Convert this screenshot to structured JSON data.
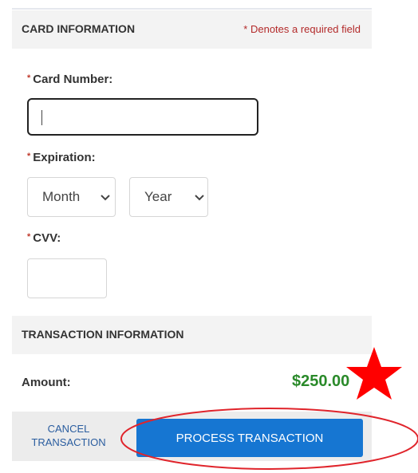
{
  "card_section": {
    "title": "CARD INFORMATION",
    "required_note": "* Denotes a required field",
    "required_mark": "*",
    "card_number_label": "Card Number:",
    "card_number_value": "",
    "expiration_label": "Expiration:",
    "month_selected": "Month",
    "year_selected": "Year",
    "cvv_label": "CVV:",
    "cvv_value": ""
  },
  "transaction_section": {
    "title": "TRANSACTION INFORMATION",
    "amount_label": "Amount:",
    "amount_value": "$250.00"
  },
  "footer": {
    "cancel_line1": "CANCEL",
    "cancel_line2": "TRANSACTION",
    "process_label": "PROCESS TRANSACTION"
  },
  "annotations": {
    "star_color": "#ff0000",
    "ellipse_color": "#e0242b"
  },
  "colors": {
    "accent": "#1676d2",
    "amount": "#2a8a2a",
    "required": "#b32a2a"
  }
}
